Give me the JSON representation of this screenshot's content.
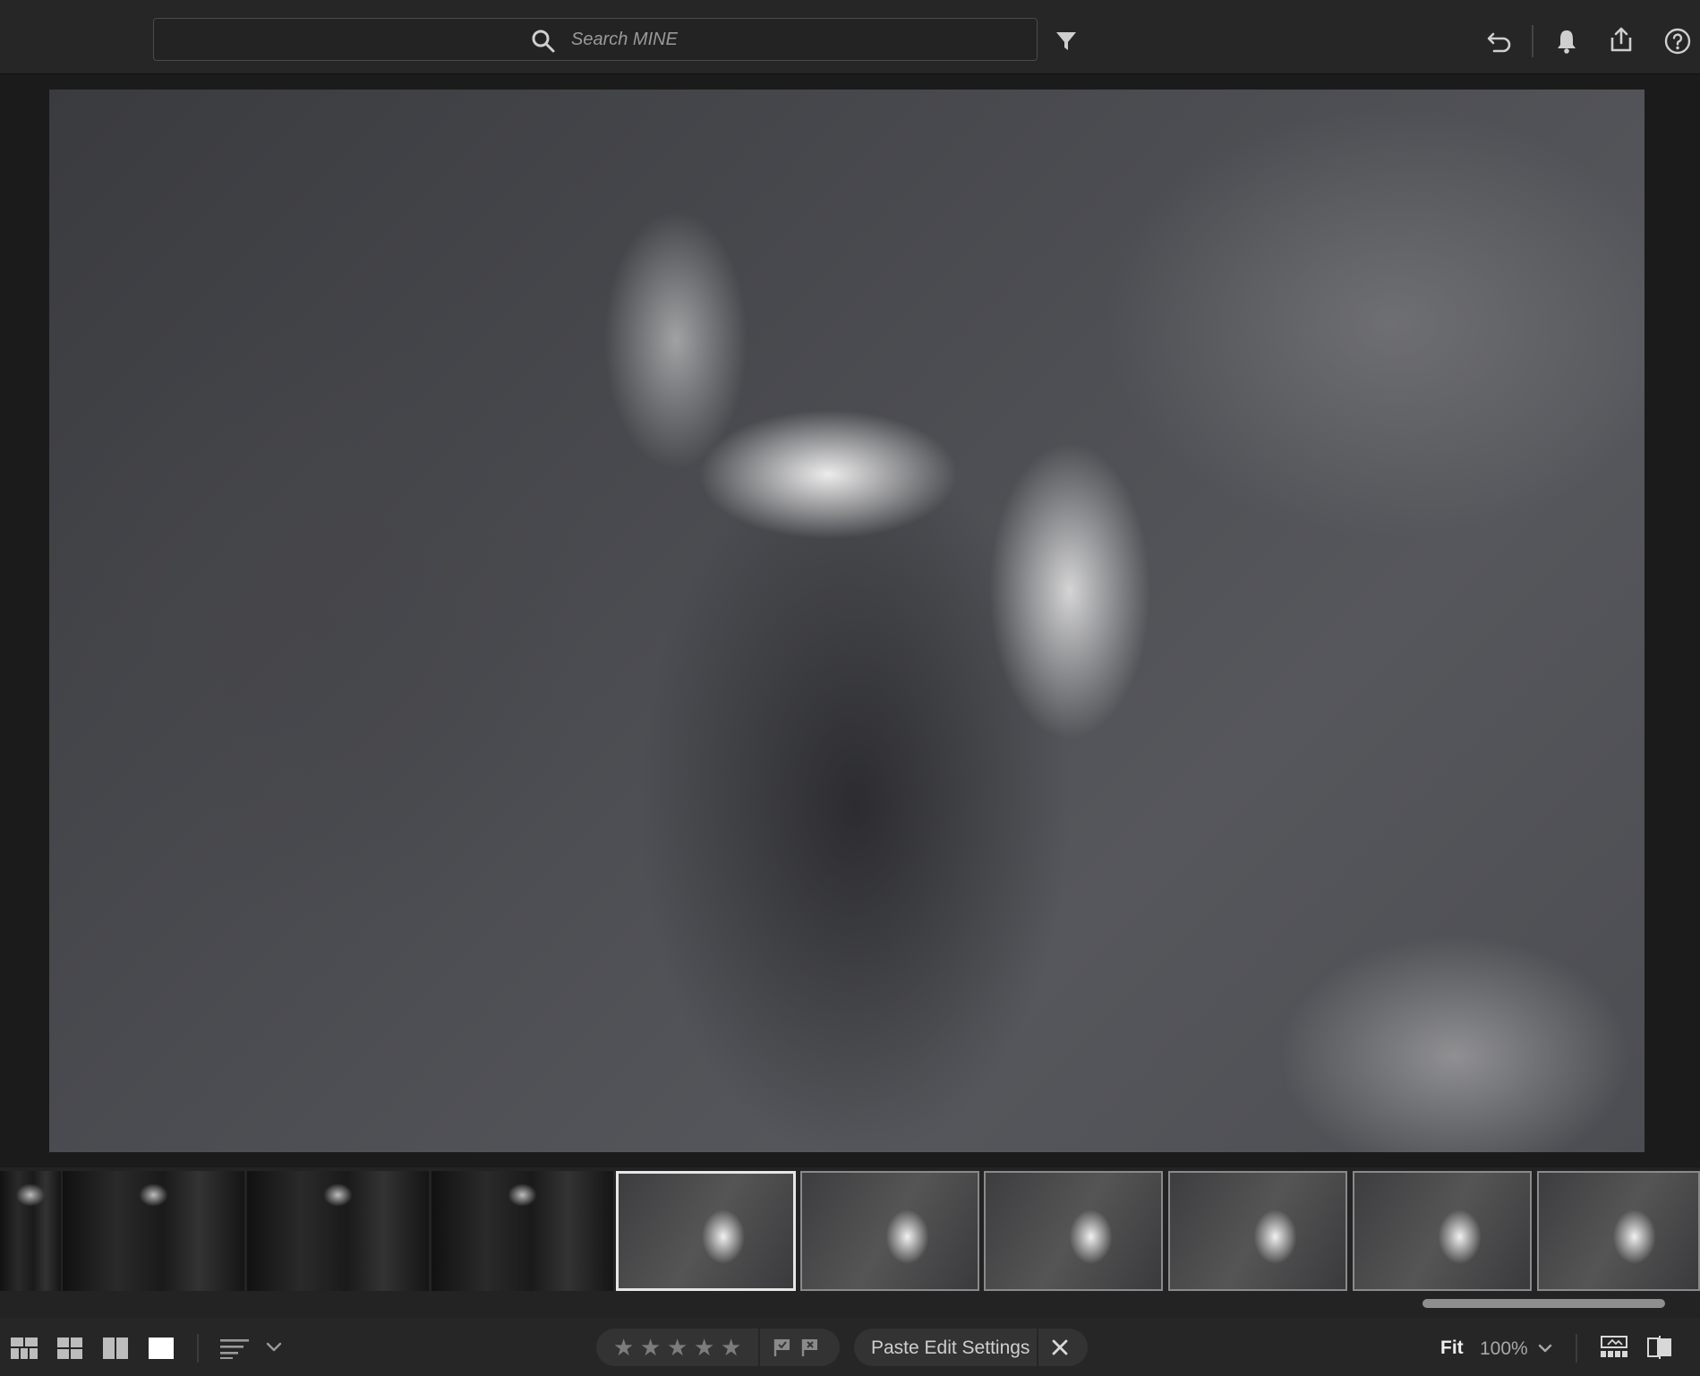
{
  "search": {
    "placeholder": "Search MINE"
  },
  "header_icons": [
    "filter-icon",
    "undo-icon",
    "bell-icon",
    "share-icon",
    "help-icon"
  ],
  "filmstrip": {
    "thumbnails": [
      {
        "tone": "dark"
      },
      {
        "tone": "dark"
      },
      {
        "tone": "dark"
      },
      {
        "tone": "dark"
      },
      {
        "tone": "light",
        "selected": true
      },
      {
        "tone": "light"
      },
      {
        "tone": "light"
      },
      {
        "tone": "light"
      },
      {
        "tone": "light"
      },
      {
        "tone": "light"
      }
    ]
  },
  "bottom_bar": {
    "view_icons": [
      "grid-layout-icon",
      "square-grid-icon",
      "compare-icon",
      "single-view-icon"
    ],
    "rating_stars": [
      "★",
      "★",
      "★",
      "★",
      "★"
    ],
    "paste_label": "Paste Edit Settings",
    "fit_label": "Fit",
    "zoom_label": "100%"
  },
  "colors": {
    "background": "#1a1a1a",
    "toolbar": "#262626",
    "selected_border": "#e6e6e6"
  }
}
